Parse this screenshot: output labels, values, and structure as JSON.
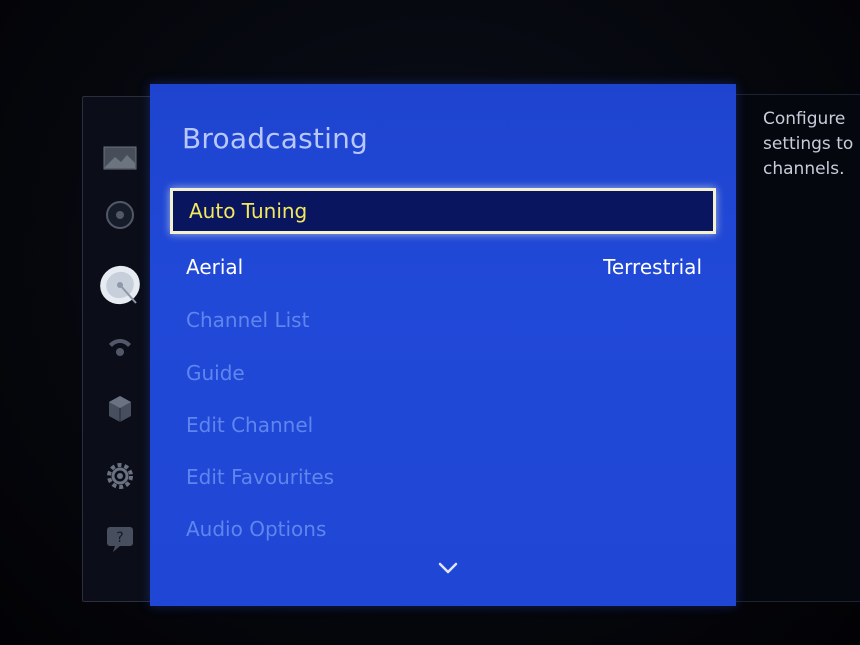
{
  "sidebar": {
    "icons": [
      {
        "name": "picture-icon"
      },
      {
        "name": "sound-icon"
      },
      {
        "name": "broadcasting-icon",
        "active": true
      },
      {
        "name": "network-icon"
      },
      {
        "name": "smart-features-icon"
      },
      {
        "name": "system-gear-icon"
      },
      {
        "name": "support-icon"
      }
    ]
  },
  "menu": {
    "title": "Broadcasting",
    "items": [
      {
        "label": "Auto Tuning",
        "value": "",
        "state": "selected"
      },
      {
        "label": "Aerial",
        "value": "Terrestrial",
        "state": "active"
      },
      {
        "label": "Channel List",
        "value": "",
        "state": "disabled"
      },
      {
        "label": "Guide",
        "value": "",
        "state": "disabled"
      },
      {
        "label": "Edit Channel",
        "value": "",
        "state": "disabled"
      },
      {
        "label": "Edit Favourites",
        "value": "",
        "state": "disabled"
      },
      {
        "label": "Audio Options",
        "value": "",
        "state": "disabled"
      }
    ]
  },
  "description": {
    "lines": [
      "Configure",
      "settings to",
      "channels."
    ]
  },
  "colors": {
    "panel": "#2149d8",
    "selected_text": "#f4e95a",
    "disabled_text": "#5f86ee"
  }
}
